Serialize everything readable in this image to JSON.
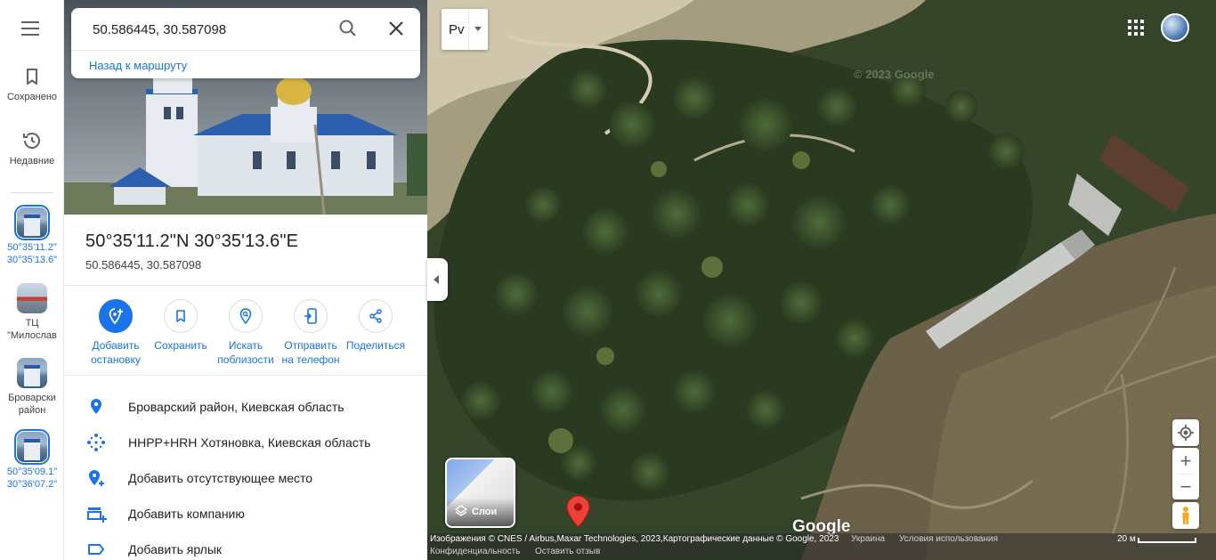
{
  "rail": {
    "saved": "Сохранено",
    "recent": "Недавние",
    "items": [
      {
        "line1": "50°35'11.2\"",
        "line2": "30°35'13.6\""
      },
      {
        "line1": "ТЦ",
        "line2": "\"Милослав"
      },
      {
        "line1": "Броварски",
        "line2": "район"
      },
      {
        "line1": "50°35'09.1\"",
        "line2": "30°36'07.2\""
      }
    ]
  },
  "search": {
    "value": "50.586445, 30.587098",
    "back_link": "Назад к маршруту"
  },
  "place": {
    "title": "50°35'11.2\"N 30°35'13.6\"E",
    "subtitle": "50.586445, 30.587098"
  },
  "actions": [
    {
      "line1": "Добавить",
      "line2": "остановку",
      "icon": "add-stop-icon"
    },
    {
      "line1": "Сохранить",
      "line2": "",
      "icon": "bookmark-icon"
    },
    {
      "line1": "Искать",
      "line2": "поблизости",
      "icon": "nearby-icon"
    },
    {
      "line1": "Отправить",
      "line2": "на телефон",
      "icon": "send-to-phone-icon"
    },
    {
      "line1": "Поделиться",
      "line2": "",
      "icon": "share-icon"
    }
  ],
  "details": [
    {
      "text": "Броварский район, Киевская область",
      "icon": "location-pin-icon"
    },
    {
      "text": "HHPP+HRH Хотяновка, Киевская область",
      "icon": "plus-code-icon"
    },
    {
      "text": "Добавить отсутствующее место",
      "icon": "add-place-icon"
    },
    {
      "text": "Добавить компанию",
      "icon": "add-business-icon"
    },
    {
      "text": "Добавить ярлык",
      "icon": "label-icon"
    }
  ],
  "map": {
    "lang_button": "Рv",
    "layers_label": "Слои",
    "google_logo": "Google",
    "watermark": "© 2023 Google",
    "attribution": "Изображения © CNES / Airbus,Maxar Technologies, 2023,Картографические данные © Google, 2023",
    "country": "Украина",
    "terms": "Условия использования",
    "privacy": "Конфиденциальность",
    "feedback": "Оставить отзыв",
    "scale": "20 м"
  },
  "colors": {
    "accent": "#1a73e8",
    "pin": "#ea4335"
  }
}
